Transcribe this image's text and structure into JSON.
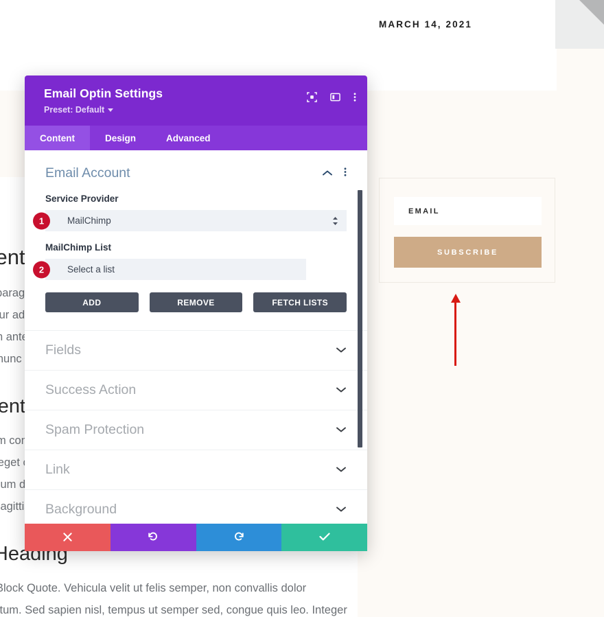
{
  "page": {
    "date": "MARCH 14, 2021",
    "article": {
      "heading_1": "Content Heading Written",
      "paragraphs_1": [
        "This is a paragraph. Lorem ipsum dolor sit amet,",
        "consectetur adipiscing elit. Nunc vitae",
        "sollicitudin ante, ut voluptatis. Sed",
        "convallis nunc erat vitae"
      ],
      "heading_2": "Different Heading Here",
      "paragraphs_2": [
        "Vestibulum commodo lacus non ante",
        "posuere, eget cursus tempus tempor",
        "Lorem ipsum dolor sit platea dictumst",
        "Aliquam sagittis tempus"
      ],
      "heading_3": "Last Heading",
      "paragraphs_3": [
        "This is a Block Quote. Vehicula velit ut felis semper, non convallis dolor",
        "condimentum. Sed sapien nisl, tempus ut semper sed, congue quis leo. Integer"
      ]
    },
    "optin": {
      "email_label": "EMAIL",
      "subscribe_label": "SUBSCRIBE",
      "accent_color": "#ceab87"
    },
    "annotation": {
      "arrow_color": "#d81a13"
    }
  },
  "modal": {
    "title": "Email Optin Settings",
    "preset_label": "Preset: Default",
    "header_color": "#7c29cf",
    "header_icons": [
      {
        "name": "focus-icon",
        "label": "Focus view"
      },
      {
        "name": "layout-split-icon",
        "label": "Change layout"
      },
      {
        "name": "more-vertical-icon",
        "label": "More options"
      }
    ],
    "tabs": [
      {
        "label": "Content",
        "active": true
      },
      {
        "label": "Design",
        "active": false
      },
      {
        "label": "Advanced",
        "active": false
      }
    ],
    "open_section": {
      "title": "Email Account",
      "collapse_icon": "chevron-up-icon",
      "menu_icon": "more-vertical-icon",
      "fields": [
        {
          "label": "Service Provider",
          "value": "MailChimp",
          "badge": "1",
          "control": "select"
        },
        {
          "label": "MailChimp List",
          "value": "Select a list",
          "badge": "2",
          "control": "select"
        }
      ],
      "buttons": [
        {
          "label": "ADD"
        },
        {
          "label": "REMOVE"
        },
        {
          "label": "FETCH LISTS"
        }
      ]
    },
    "collapsed_sections": [
      {
        "label": "Fields"
      },
      {
        "label": "Success Action"
      },
      {
        "label": "Spam Protection"
      },
      {
        "label": "Link"
      },
      {
        "label": "Background"
      }
    ],
    "footer_buttons": [
      {
        "name": "cancel",
        "icon": "close-icon",
        "color": "#e9585a"
      },
      {
        "name": "undo",
        "icon": "undo-icon",
        "color": "#8637d9"
      },
      {
        "name": "redo",
        "icon": "redo-icon",
        "color": "#2d8ed8"
      },
      {
        "name": "save",
        "icon": "check-icon",
        "color": "#2fbf9d"
      }
    ]
  }
}
